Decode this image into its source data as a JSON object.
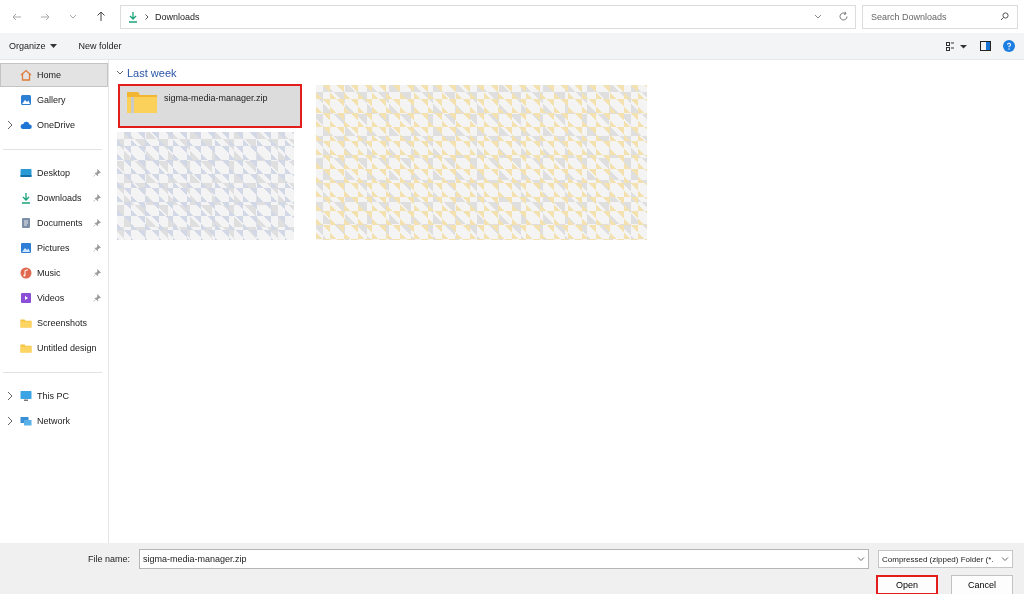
{
  "address_bar": {
    "path": "Downloads"
  },
  "search": {
    "placeholder": "Search Downloads"
  },
  "toolbar": {
    "organize": "Organize",
    "new_folder": "New folder"
  },
  "sidebar": {
    "groups": [
      [
        {
          "label": "Home",
          "kind": "home",
          "selected": true,
          "pinned": false,
          "expandable": false
        },
        {
          "label": "Gallery",
          "kind": "gallery",
          "selected": false,
          "pinned": false,
          "expandable": false
        },
        {
          "label": "OneDrive",
          "kind": "cloud",
          "selected": false,
          "pinned": false,
          "expandable": true
        }
      ],
      [
        {
          "label": "Desktop",
          "kind": "desktop",
          "selected": false,
          "pinned": true,
          "expandable": false
        },
        {
          "label": "Downloads",
          "kind": "download",
          "selected": false,
          "pinned": true,
          "expandable": false
        },
        {
          "label": "Documents",
          "kind": "document",
          "selected": false,
          "pinned": true,
          "expandable": false
        },
        {
          "label": "Pictures",
          "kind": "picture",
          "selected": false,
          "pinned": true,
          "expandable": false
        },
        {
          "label": "Music",
          "kind": "music",
          "selected": false,
          "pinned": true,
          "expandable": false
        },
        {
          "label": "Videos",
          "kind": "video",
          "selected": false,
          "pinned": true,
          "expandable": false
        },
        {
          "label": "Screenshots",
          "kind": "folder",
          "selected": false,
          "pinned": false,
          "expandable": false
        },
        {
          "label": "Untitled design",
          "kind": "folder",
          "selected": false,
          "pinned": false,
          "expandable": false
        }
      ],
      [
        {
          "label": "This PC",
          "kind": "pc",
          "selected": false,
          "pinned": false,
          "expandable": true
        },
        {
          "label": "Network",
          "kind": "network",
          "selected": false,
          "pinned": false,
          "expandable": true
        }
      ]
    ]
  },
  "content": {
    "group_title": "Last week",
    "files": [
      {
        "name": "sigma-media-manager.zip",
        "selected": true,
        "highlighted": true
      }
    ]
  },
  "footer": {
    "file_name_label": "File name:",
    "file_name": "sigma-media-manager.zip",
    "file_type": "Compressed (zipped) Folder (*.",
    "buttons": [
      {
        "label": "Open",
        "highlighted": true
      },
      {
        "label": "Cancel",
        "highlighted": false
      }
    ]
  }
}
